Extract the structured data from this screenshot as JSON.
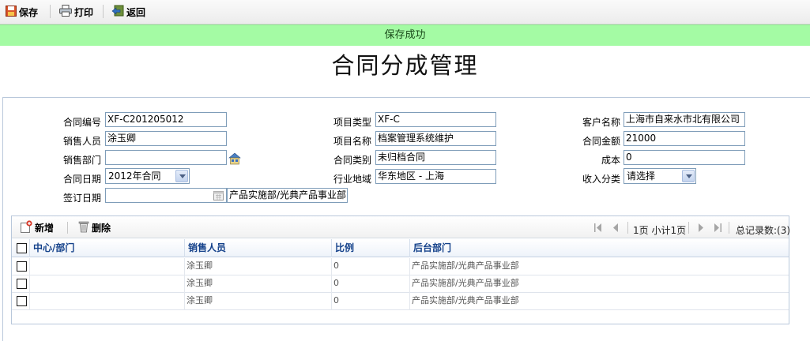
{
  "toolbar": {
    "save_label": "保存",
    "print_label": "打印",
    "back_label": "返回"
  },
  "status_message": "保存成功",
  "page_title": "合同分成管理",
  "form": {
    "contract_no": {
      "label": "合同编号",
      "value": "XF-C201205012"
    },
    "project_type": {
      "label": "项目类型",
      "value": "XF-C"
    },
    "customer_name": {
      "label": "客户名称",
      "value": "上海市自来水市北有限公司"
    },
    "salesperson": {
      "label": "销售人员",
      "value": "涂玉卿"
    },
    "project_name": {
      "label": "项目名称",
      "value": "档案管理系统维护"
    },
    "contract_amount": {
      "label": "合同金额",
      "value": "21000"
    },
    "sales_dept": {
      "label": "销售部门",
      "value": ""
    },
    "contract_category": {
      "label": "合同类别",
      "value": "未归档合同"
    },
    "cost": {
      "label": "成本",
      "value": "0"
    },
    "contract_date": {
      "label": "合同日期",
      "value": "2012年合同"
    },
    "industry_region": {
      "label": "行业地域",
      "value": "华东地区  - 上海"
    },
    "income_category": {
      "label": "收入分类",
      "value": "请选择"
    },
    "sign_date": {
      "label": "签订日期",
      "value": ""
    },
    "dept_text": "产品实施部/光典产品事业部"
  },
  "grid": {
    "add_label": "新增",
    "delete_label": "删除",
    "page_info": "1页 小计1页",
    "total_records": "总记录数:(3)",
    "columns": [
      "中心/部门",
      "销售人员",
      "比例",
      "后台部门"
    ],
    "rows": [
      {
        "center_dept": "",
        "salesperson": "涂玉卿",
        "ratio": "0",
        "back_dept": "产品实施部/光典产品事业部"
      },
      {
        "center_dept": "",
        "salesperson": "涂玉卿",
        "ratio": "0",
        "back_dept": "产品实施部/光典产品事业部"
      },
      {
        "center_dept": "",
        "salesperson": "涂玉卿",
        "ratio": "0",
        "back_dept": "产品实施部/光典产品事业部"
      }
    ]
  },
  "colors": {
    "success_bg": "#a4fba4",
    "grid_header_text": "#15428b",
    "input_border": "#7f9db9"
  }
}
